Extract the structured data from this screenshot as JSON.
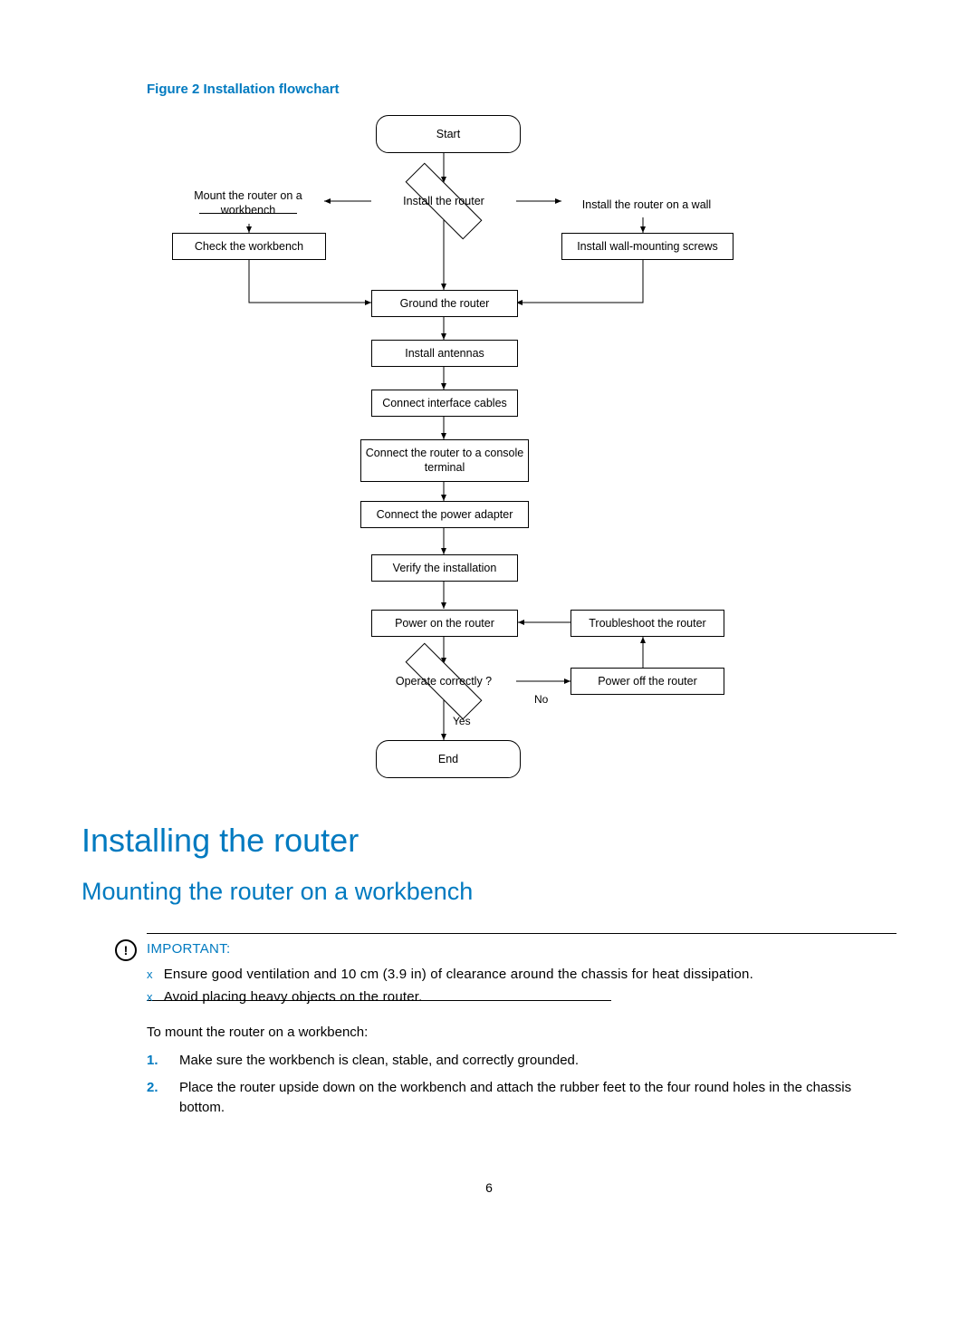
{
  "figure_label": "Figure 2 Installation flowchart",
  "flow": {
    "start": "Start",
    "install_router": "Install the router",
    "mount_workbench": "Mount the router on a workbench",
    "check_workbench": "Check the workbench",
    "install_wall": "Install the router on a wall",
    "install_wall_screws": "Install wall-mounting screws",
    "ground": "Ground the router",
    "antennas": "Install antennas",
    "cables": "Connect interface cables",
    "console": "Connect the router to a console terminal",
    "power_adapter": "Connect the power adapter",
    "verify": "Verify the installation",
    "power_on": "Power on the router",
    "troubleshoot": "Troubleshoot the router",
    "operate": "Operate correctly ?",
    "power_off": "Power off the router",
    "yes": "Yes",
    "no": "No",
    "end": "End"
  },
  "h1": "Installing the router",
  "h2": "Mounting the router on a workbench",
  "important": {
    "title": "IMPORTANT:",
    "items": [
      "Ensure good ventilation and 10 cm (3.9 in) of clearance around the chassis for heat dissipation.",
      "Avoid placing heavy objects on the router."
    ]
  },
  "intro": "To mount the router on a workbench:",
  "steps": [
    "Make sure the workbench is clean, stable, and correctly grounded.",
    "Place the router upside down on the workbench and attach the rubber feet to the four round holes in the chassis bottom."
  ],
  "page_number": "6",
  "chart_data": {
    "type": "flowchart",
    "nodes": [
      {
        "id": "start",
        "label": "Start",
        "shape": "terminator"
      },
      {
        "id": "install_router",
        "label": "Install the router",
        "shape": "decision"
      },
      {
        "id": "mount_workbench",
        "label": "Mount the router on a workbench",
        "shape": "process"
      },
      {
        "id": "check_workbench",
        "label": "Check the workbench",
        "shape": "process"
      },
      {
        "id": "install_wall",
        "label": "Install the router on a wall",
        "shape": "process"
      },
      {
        "id": "install_wall_screws",
        "label": "Install wall-mounting screws",
        "shape": "process"
      },
      {
        "id": "ground",
        "label": "Ground the router",
        "shape": "process"
      },
      {
        "id": "antennas",
        "label": "Install antennas",
        "shape": "process"
      },
      {
        "id": "cables",
        "label": "Connect interface cables",
        "shape": "process"
      },
      {
        "id": "console",
        "label": "Connect the router to a console terminal",
        "shape": "process"
      },
      {
        "id": "power_adapter",
        "label": "Connect the power adapter",
        "shape": "process"
      },
      {
        "id": "verify",
        "label": "Verify the installation",
        "shape": "process"
      },
      {
        "id": "power_on",
        "label": "Power on the router",
        "shape": "process"
      },
      {
        "id": "troubleshoot",
        "label": "Troubleshoot the router",
        "shape": "process"
      },
      {
        "id": "operate",
        "label": "Operate correctly ?",
        "shape": "decision"
      },
      {
        "id": "power_off",
        "label": "Power off the router",
        "shape": "process"
      },
      {
        "id": "end",
        "label": "End",
        "shape": "terminator"
      }
    ],
    "edges": [
      {
        "from": "start",
        "to": "install_router"
      },
      {
        "from": "install_router",
        "to": "mount_workbench"
      },
      {
        "from": "install_router",
        "to": "install_wall"
      },
      {
        "from": "mount_workbench",
        "to": "check_workbench"
      },
      {
        "from": "install_wall",
        "to": "install_wall_screws"
      },
      {
        "from": "check_workbench",
        "to": "ground"
      },
      {
        "from": "install_wall_screws",
        "to": "ground"
      },
      {
        "from": "install_router",
        "to": "ground"
      },
      {
        "from": "ground",
        "to": "antennas"
      },
      {
        "from": "antennas",
        "to": "cables"
      },
      {
        "from": "cables",
        "to": "console"
      },
      {
        "from": "console",
        "to": "power_adapter"
      },
      {
        "from": "power_adapter",
        "to": "verify"
      },
      {
        "from": "verify",
        "to": "power_on"
      },
      {
        "from": "power_on",
        "to": "operate"
      },
      {
        "from": "operate",
        "to": "end",
        "label": "Yes"
      },
      {
        "from": "operate",
        "to": "power_off",
        "label": "No"
      },
      {
        "from": "power_off",
        "to": "troubleshoot"
      },
      {
        "from": "troubleshoot",
        "to": "power_on"
      }
    ]
  }
}
